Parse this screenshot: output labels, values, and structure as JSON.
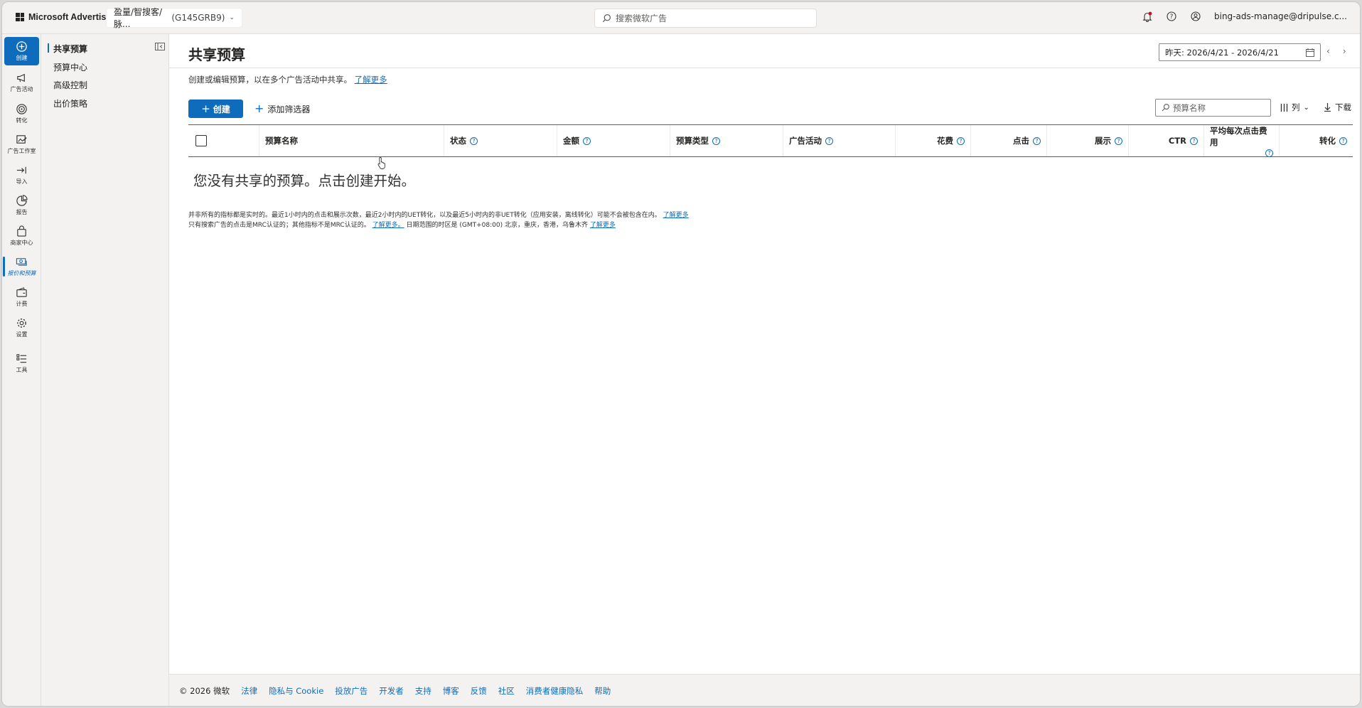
{
  "topbar": {
    "brand": "Microsoft Advertising",
    "account_name": "盈量/智搜客/脉...",
    "account_id": "(G145GRB9)",
    "search_placeholder": "搜索微软广告",
    "user_email": "bing-ads-manage@dripulse.c..."
  },
  "rail": {
    "items": [
      {
        "label": "创建",
        "icon": "plus-circle-icon"
      },
      {
        "label": "广告活动",
        "icon": "megaphone-icon"
      },
      {
        "label": "转化",
        "icon": "target-icon"
      },
      {
        "label": "广告工作室",
        "icon": "image-edit-icon"
      },
      {
        "label": "导入",
        "icon": "import-icon"
      },
      {
        "label": "报告",
        "icon": "chart-pie-icon"
      },
      {
        "label": "商家中心",
        "icon": "shopping-bag-icon"
      },
      {
        "label": "报价和预算",
        "icon": "money-icon"
      },
      {
        "label": "计费",
        "icon": "wallet-icon"
      },
      {
        "label": "设置",
        "icon": "gear-icon"
      },
      {
        "label": "工具",
        "icon": "tools-list-icon"
      }
    ]
  },
  "subnav": {
    "items": [
      "共享预算",
      "预算中心",
      "高级控制",
      "出价策略"
    ]
  },
  "main": {
    "title": "共享预算",
    "date_range": "昨天: 2026/4/21 - 2026/4/21",
    "description": "创建或编辑预算，以在多个广告活动中共享。",
    "learn_more": "了解更多",
    "create_label": "创建",
    "add_filter_label": "添加筛选器",
    "filter_placeholder": "预算名称",
    "columns_label": "列",
    "download_label": "下载",
    "table": {
      "headers": [
        "预算名称",
        "状态",
        "金额",
        "预算类型",
        "广告活动",
        "花费",
        "点击",
        "展示",
        "CTR",
        "平均每次点击费用",
        "转化"
      ]
    },
    "empty_message": "您没有共享的预算。点击创建开始。",
    "footnote1": "并非所有的指标都是实时的。最近1小时内的点击和展示次数，最近2小时内的UET转化，以及最近5小时内的非UET转化（应用安装，离线转化）可能不会被包含在内。",
    "footnote1_link": "了解更多",
    "footnote2a": "只有搜索广告的点击是MRC认证的；其他指标不是MRC认证的。",
    "footnote2_link1": "了解更多。",
    "footnote2b": "日期范围的时区是 (GMT+08:00) 北京，重庆，香港，乌鲁木齐",
    "footnote2_link2": "了解更多"
  },
  "footer": {
    "copyright": "© 2026 微软",
    "links": [
      "法律",
      "隐私与 Cookie",
      "投放广告",
      "开发者",
      "支持",
      "博客",
      "反馈",
      "社区",
      "消费者健康隐私",
      "帮助"
    ]
  },
  "colors": {
    "accent": "#0f6cbd",
    "chrome": "#f3f2f1"
  }
}
